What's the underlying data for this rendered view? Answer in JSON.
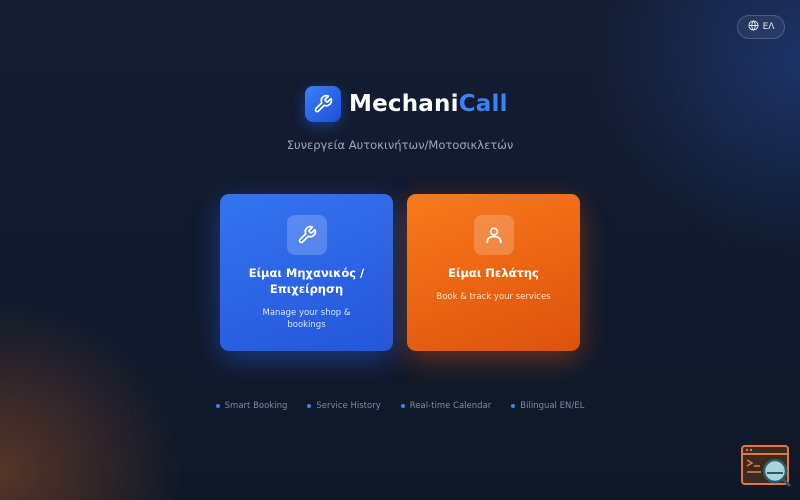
{
  "language": {
    "label": "ΕΛ",
    "icon": "globe-icon"
  },
  "brand": {
    "name_part1": "Mechani",
    "name_part2": "Call",
    "logo_icon": "wrench-icon",
    "accent": "#3b82f6"
  },
  "subtitle": "Συνεργεία Αυτοκινήτων/Μοτοσικλετών",
  "cards": {
    "mechanic": {
      "title": "Είμαι Μηχανικός / Επιχείρηση",
      "description": "Manage your shop & bookings",
      "icon": "wrench-icon",
      "color": "#2f6bec"
    },
    "client": {
      "title": "Είμαι Πελάτης",
      "description": "Book & track your services",
      "icon": "user-icon",
      "color": "#f0701a"
    }
  },
  "features": [
    "Smart Booking",
    "Service History",
    "Real-time Calendar",
    "Bilingual EN/EL"
  ],
  "widget": {
    "icon": "console-search-icon"
  }
}
